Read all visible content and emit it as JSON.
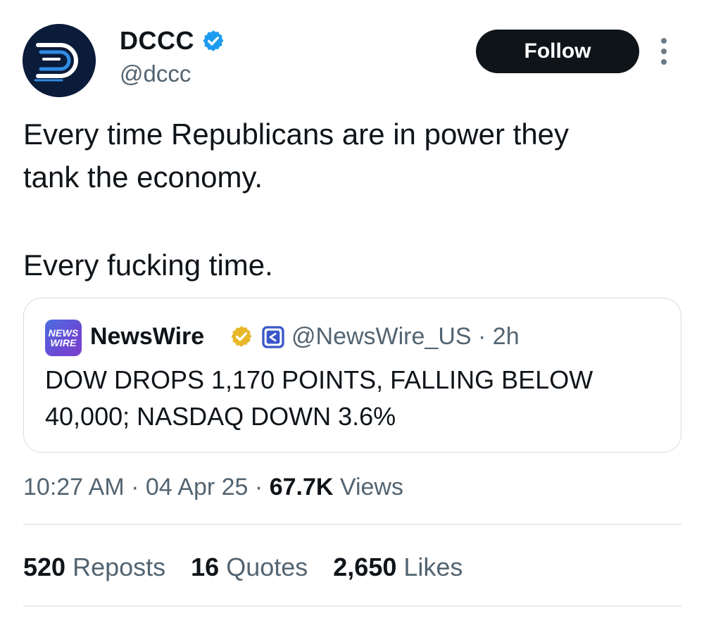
{
  "author": {
    "display_name": "DCCC",
    "handle": "@dccc",
    "verified": true,
    "avatar_icon": "dccc-logo-icon"
  },
  "follow_label": "Follow",
  "more_icon": "more-vertical-icon",
  "tweet": {
    "lines": [
      "Every time Republicans are in power they",
      "tank the economy.",
      "Every fucking time."
    ]
  },
  "quote": {
    "logo_text_top": "NEWS",
    "logo_text_bottom": "WIRE",
    "name": "NewsWire",
    "handle": "@NewsWire_US",
    "separator": "·",
    "time": "2h",
    "lines": [
      "DOW DROPS 1,170 POINTS, FALLING BELOW",
      "40,000; NASDAQ DOWN 3.6%"
    ]
  },
  "meta": {
    "time": "10:27 AM",
    "date": "04 Apr 25",
    "sep": "·",
    "views_count": "67.7K",
    "views_label": "Views"
  },
  "stats": {
    "reposts_count": "520",
    "reposts_label": "Reposts",
    "quotes_count": "16",
    "quotes_label": "Quotes",
    "likes_count": "2,650",
    "likes_label": "Likes"
  },
  "colors": {
    "verified_blue": "#1d9bf0",
    "gold_badge": "#e8b829",
    "text_secondary": "#536471",
    "follow_bg": "#0f1419"
  }
}
